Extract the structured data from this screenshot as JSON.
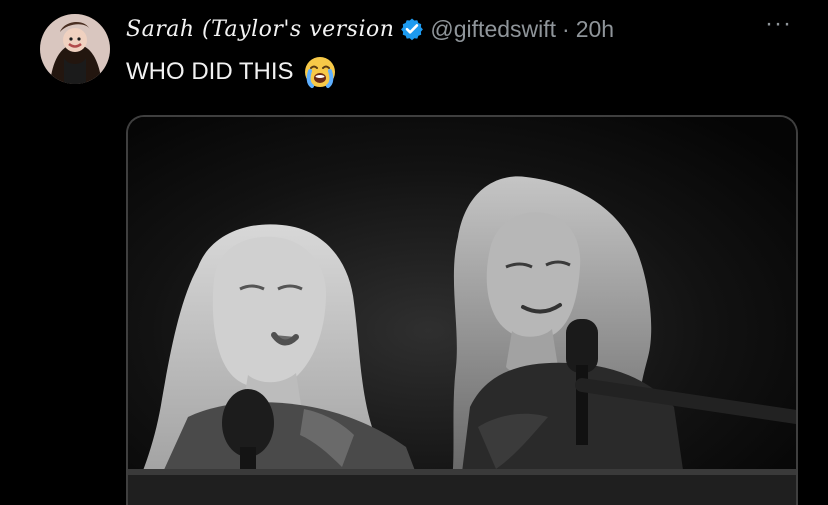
{
  "tweet": {
    "display_name": "Sarah (Taylor's version",
    "verified_icon": "verified-badge-icon",
    "handle": "@giftedswift",
    "separator": "·",
    "time": "20h",
    "more_label": "···",
    "text": "WHO DID THIS",
    "emoji_icon": "loudly-crying-face-icon"
  },
  "media": {
    "icon": "photo-image",
    "theme": "black-and-white concert photo"
  },
  "colors": {
    "background": "#000000",
    "text": "#e7e9ea",
    "muted": "#8f959a",
    "verified": "#1d9bf0",
    "media_border": "#3f3f3f"
  }
}
